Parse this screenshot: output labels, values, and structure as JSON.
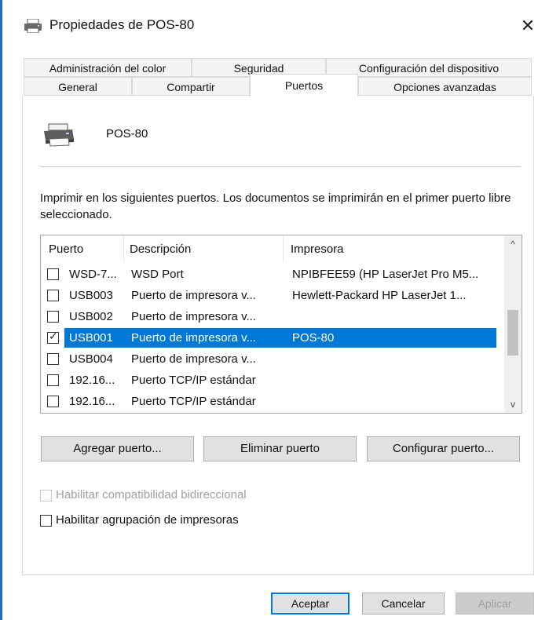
{
  "window": {
    "title": "Propiedades de POS-80",
    "close_glyph": "✕"
  },
  "tabs": {
    "row1": [
      {
        "label": "Administración del color"
      },
      {
        "label": "Seguridad"
      },
      {
        "label": "Configuración del dispositivo"
      }
    ],
    "row2": [
      {
        "label": "General"
      },
      {
        "label": "Compartir"
      },
      {
        "label": "Puertos",
        "active": true
      },
      {
        "label": "Opciones avanzadas"
      }
    ]
  },
  "printer": {
    "name": "POS-80",
    "icon": "printer-icon"
  },
  "description": "Imprimir en los siguientes puertos. Los documentos se imprimirán en el primer puerto libre seleccionado.",
  "ports_table": {
    "headers": [
      "Puerto",
      "Descripción",
      "Impresora"
    ],
    "rows": [
      {
        "checked": false,
        "port": "WSD-7...",
        "desc": "WSD Port",
        "printer": "NPIBFEE59 (HP LaserJet Pro M5..."
      },
      {
        "checked": false,
        "port": "USB003",
        "desc": "Puerto de impresora v...",
        "printer": "Hewlett-Packard HP LaserJet 1..."
      },
      {
        "checked": false,
        "port": "USB002",
        "desc": "Puerto de impresora v...",
        "printer": ""
      },
      {
        "checked": true,
        "selected": true,
        "port": "USB001",
        "desc": "Puerto de impresora v...",
        "printer": "POS-80"
      },
      {
        "checked": false,
        "port": "USB004",
        "desc": "Puerto de impresora v...",
        "printer": ""
      },
      {
        "checked": false,
        "port": "192.16...",
        "desc": "Puerto TCP/IP estándar",
        "printer": ""
      },
      {
        "checked": false,
        "port": "192.16...",
        "desc": "Puerto TCP/IP estándar",
        "printer": ""
      }
    ],
    "scroll_up_glyph": "^",
    "scroll_down_glyph": "v"
  },
  "port_buttons": {
    "add": "Agregar puerto...",
    "delete": "Eliminar puerto",
    "configure": "Configurar puerto..."
  },
  "options": {
    "bidirectional": {
      "label": "Habilitar compatibilidad bidireccional",
      "enabled": false,
      "checked": false
    },
    "pooling": {
      "label": "Habilitar agrupación de impresoras",
      "enabled": true,
      "checked": false
    }
  },
  "dialog_buttons": {
    "ok": "Aceptar",
    "cancel": "Cancelar",
    "apply": "Aplicar"
  },
  "colors": {
    "selection": "#0078d7",
    "accent": "#1e6fc7"
  }
}
